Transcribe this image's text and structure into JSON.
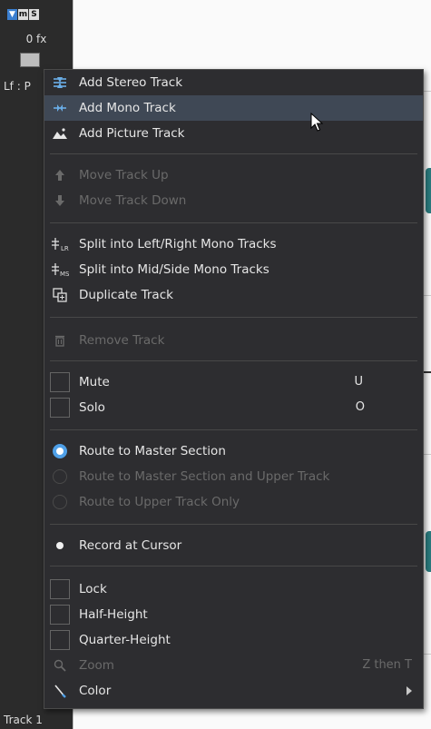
{
  "track_header": {
    "buttons": [
      "▼",
      "m",
      "S"
    ],
    "fx_label": "0 fx",
    "pan_label": "Lf : P",
    "track_name": "Track 1"
  },
  "menu": {
    "items": [
      {
        "label": "Add Stereo Track",
        "icon": "stereo-track-icon"
      },
      {
        "label": "Add Mono Track",
        "icon": "mono-track-icon"
      },
      {
        "label": "Add Picture Track",
        "icon": "picture-icon"
      },
      {
        "label": "Move Track Up",
        "icon": "arrow-up-icon"
      },
      {
        "label": "Move Track Down",
        "icon": "arrow-down-icon"
      },
      {
        "label": "Split into Left/Right Mono Tracks",
        "icon": "split-lr-icon"
      },
      {
        "label": "Split into Mid/Side Mono Tracks",
        "icon": "split-ms-icon"
      },
      {
        "label": "Duplicate Track",
        "icon": "duplicate-icon"
      },
      {
        "label": "Remove Track",
        "icon": "trash-icon"
      },
      {
        "label": "Mute",
        "shortcut": "U"
      },
      {
        "label": "Solo",
        "shortcut": "O"
      },
      {
        "label": "Route to Master Section",
        "checked": true
      },
      {
        "label": "Route to Master Section and Upper Track",
        "checked": false
      },
      {
        "label": "Route to Upper Track Only",
        "checked": false
      },
      {
        "label": "Record at Cursor"
      },
      {
        "label": "Lock"
      },
      {
        "label": "Half-Height"
      },
      {
        "label": "Quarter-Height"
      },
      {
        "label": "Zoom",
        "shortcut": "Z then T",
        "icon": "magnifier-icon"
      },
      {
        "label": "Color",
        "icon": "pen-icon"
      }
    ]
  },
  "colors": {
    "menu_bg": "#2d2d30",
    "highlight": "#3f4855",
    "accent": "#4fa0e8",
    "disabled_text": "#6a6a6a"
  }
}
